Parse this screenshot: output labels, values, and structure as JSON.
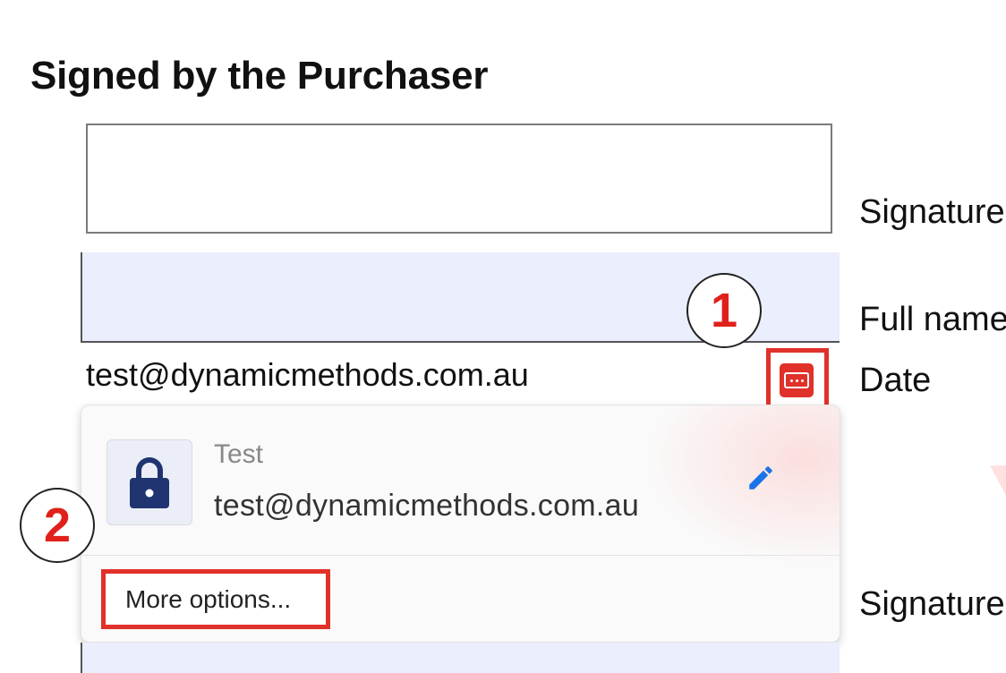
{
  "section": {
    "heading": "Signed by the Purchaser"
  },
  "fields": {
    "signature_label": "Signature",
    "full_name_label": "Full name",
    "date_label": "Date",
    "signature2_label": "Signature",
    "email_value": "test@dynamicmethods.com.au"
  },
  "annotations": {
    "step1": "1",
    "step2": "2",
    "accent_color": "#e0312a"
  },
  "password_popup": {
    "account_name": "Test",
    "account_email": "test@dynamicmethods.com.au",
    "more_options_label": "More options...",
    "lock_icon": "lock-icon",
    "edit_icon": "pencil-icon",
    "trigger_icon": "password-manager-icon"
  }
}
